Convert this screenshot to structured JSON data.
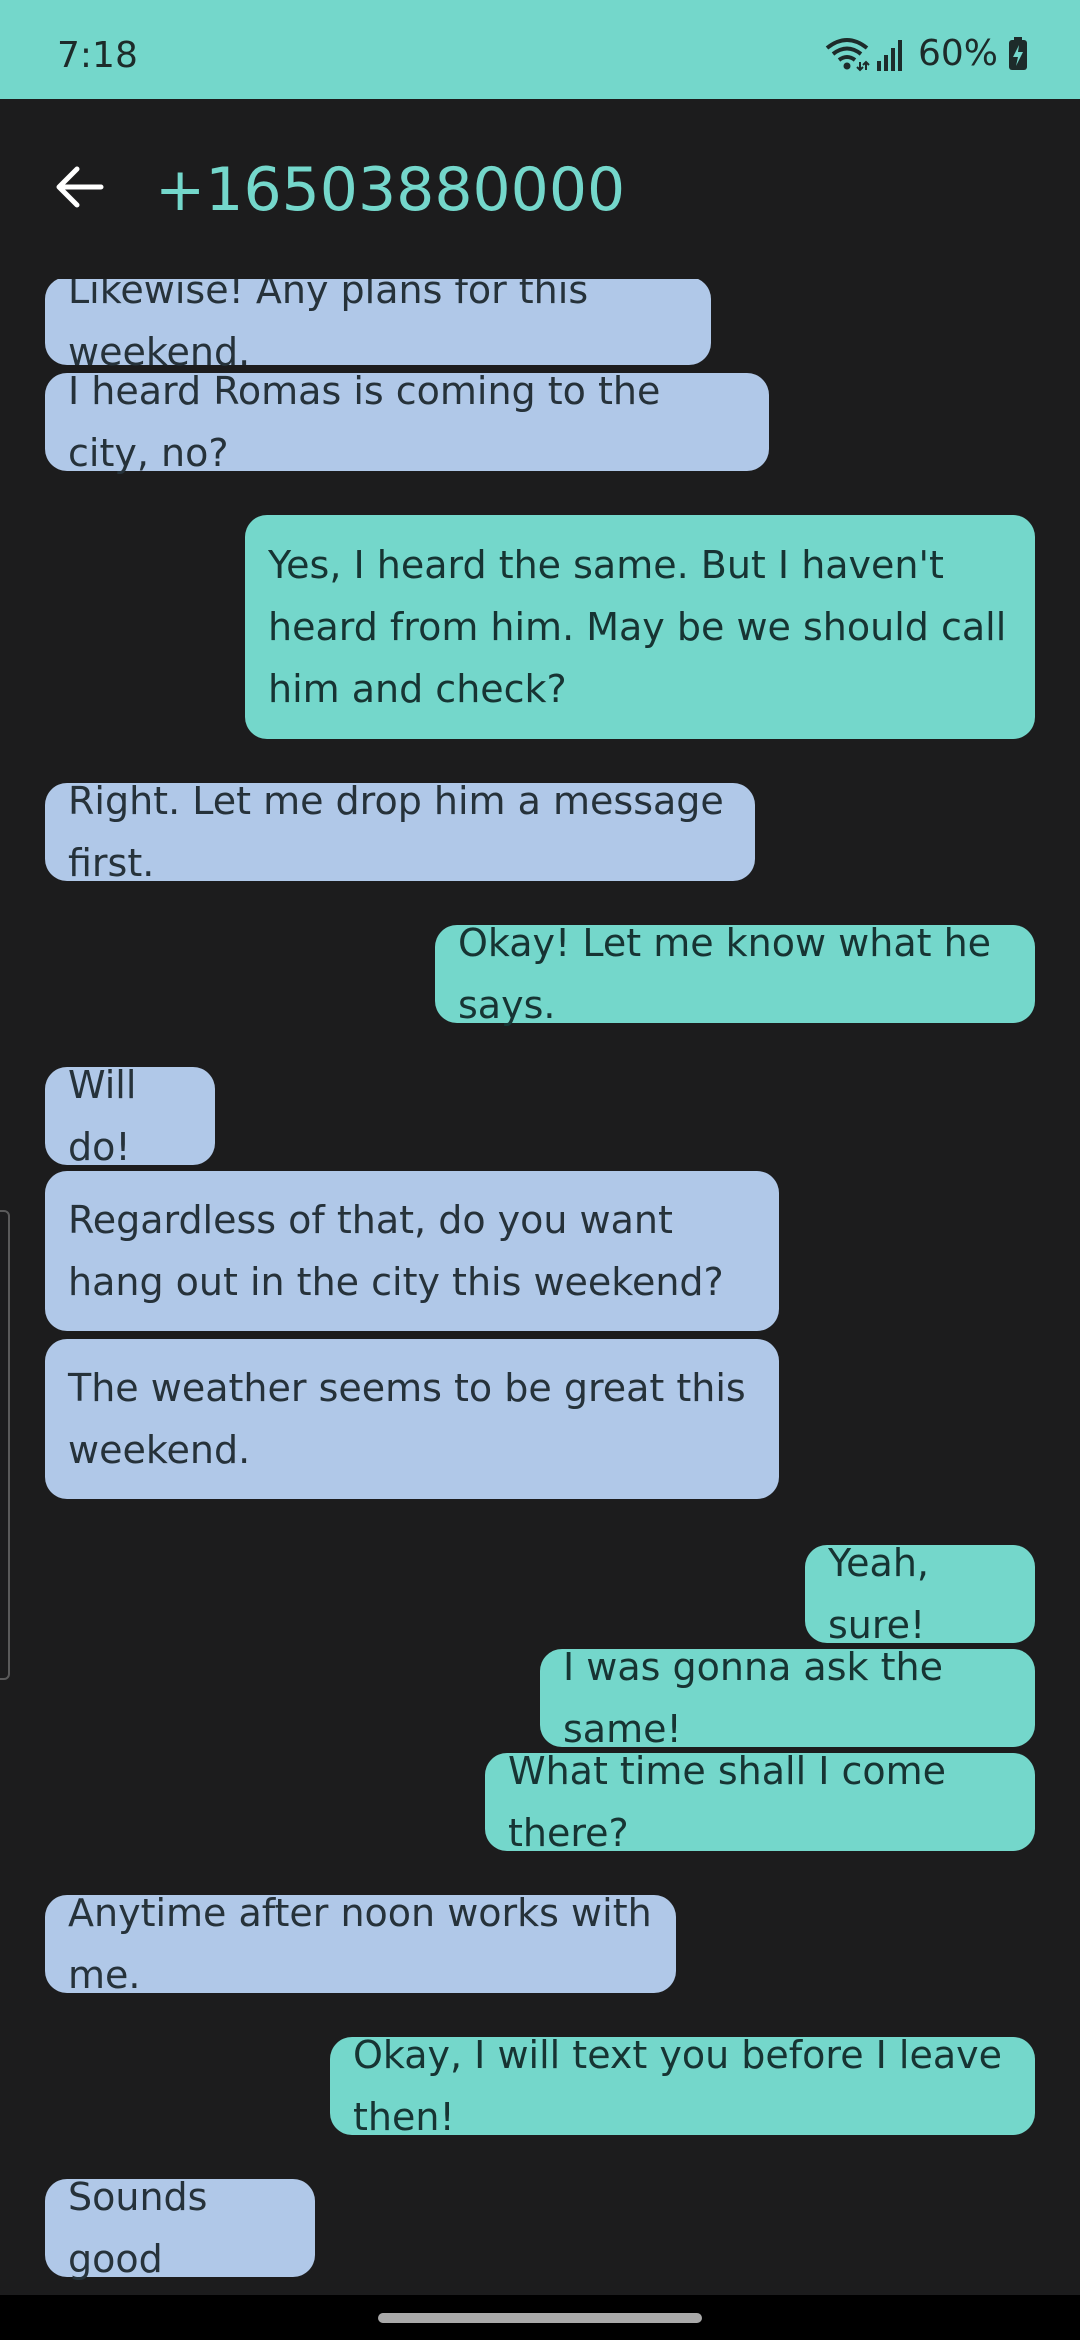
{
  "status_bar": {
    "time": "7:18",
    "battery": "60%",
    "icons": [
      "wifi-icon",
      "signal-icon",
      "battery-charging-icon"
    ]
  },
  "header": {
    "back_icon": "arrow-left-icon",
    "title": "+16503880000"
  },
  "messages": [
    {
      "dir": "in",
      "text": "Likewise! Any plans for this weekend."
    },
    {
      "dir": "in",
      "text": "I heard Romas is coming to the city, no?"
    },
    {
      "dir": "out",
      "text": "Yes, I heard the same. But I haven't heard from him. May be we should call him and check?"
    },
    {
      "dir": "in",
      "text": "Right. Let me drop him a message first."
    },
    {
      "dir": "out",
      "text": "Okay! Let me know what he says."
    },
    {
      "dir": "in",
      "text": "Will do!"
    },
    {
      "dir": "in",
      "text": "Regardless of that, do you want hang out in the city this weekend?"
    },
    {
      "dir": "in",
      "text": "The weather seems to be great this weekend."
    },
    {
      "dir": "out",
      "text": "Yeah, sure!"
    },
    {
      "dir": "out",
      "text": "I was gonna ask the same!"
    },
    {
      "dir": "out",
      "text": "What time shall I come there?"
    },
    {
      "dir": "in",
      "text": "Anytime after noon works with me."
    },
    {
      "dir": "out",
      "text": "Okay, I will text you before I leave then!"
    },
    {
      "dir": "in",
      "text": "Sounds good"
    }
  ],
  "colors": {
    "accent": "#74d7cb",
    "incoming_bubble": "#b0c8e8",
    "background": "#1c1c1d"
  }
}
